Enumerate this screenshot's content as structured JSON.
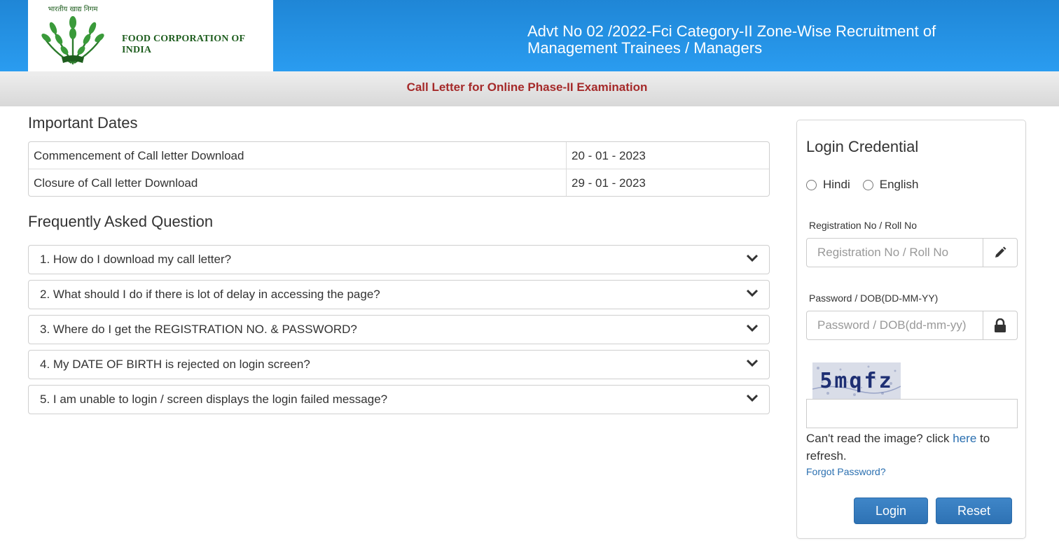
{
  "header": {
    "org_name": "FOOD CORPORATION OF INDIA",
    "emblem_text": "भारतीय खाद्य निगम",
    "emblem_icon": "fci-wheat-emblem-icon",
    "advt_title": "Advt No 02 /2022-Fci Category-II Zone-Wise Recruitment of Management Trainees / Managers"
  },
  "subheader": {
    "title": "Call Letter for Online Phase-II Examination"
  },
  "important_dates": {
    "title": "Important Dates",
    "rows": [
      {
        "label": "Commencement of Call letter Download",
        "value": "20 - 01 - 2023"
      },
      {
        "label": "Closure of Call letter Download",
        "value": "29 - 01 - 2023"
      }
    ]
  },
  "faq": {
    "title": "Frequently Asked Question",
    "items": [
      "1. How do I download my call letter?",
      "2. What should I do if there is lot of delay in accessing the page?",
      "3. Where do I get the REGISTRATION NO. & PASSWORD?",
      "4. My DATE OF BIRTH is rejected on login screen?",
      "5. I am unable to login / screen displays the login failed message?"
    ],
    "chevron_icon": "chevron-down-icon"
  },
  "login": {
    "title": "Login Credential",
    "languages": [
      "Hindi",
      "English"
    ],
    "registration_label": "Registration No / Roll No",
    "registration_placeholder": "Registration No / Roll No",
    "registration_value": "",
    "registration_icon": "pencil-icon",
    "password_label": "Password / DOB(DD-MM-YY)",
    "password_placeholder": "Password / DOB(dd-mm-yy)",
    "password_value": "",
    "password_icon": "lock-icon",
    "captcha_text": "5mqfz",
    "captcha_value": "",
    "refresh_before": "Can't read the image? click ",
    "refresh_link": "here",
    "refresh_after": " to refresh.",
    "forgot_password": "Forgot Password?",
    "login_button": "Login",
    "reset_button": "Reset"
  },
  "colors": {
    "header_blue": "#2a9cf0",
    "subheader_title": "#a52a2a",
    "org_green": "#1e5d1e",
    "button_blue": "#337ab7",
    "link_blue": "#2a6fb0"
  }
}
